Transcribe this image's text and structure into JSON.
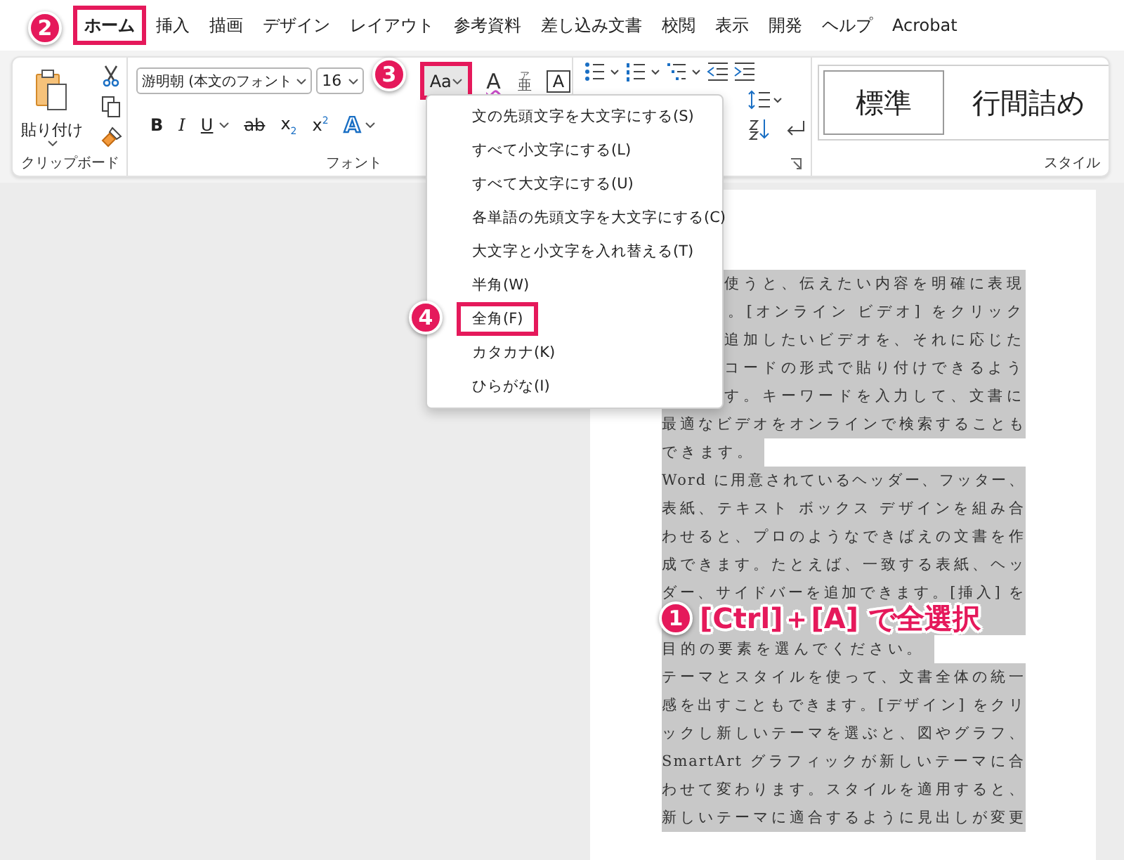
{
  "tabs": [
    {
      "label": "ホーム",
      "selected": true,
      "highlighted": true
    },
    {
      "label": "挿入",
      "selected": false,
      "highlighted": false
    },
    {
      "label": "描画",
      "selected": false,
      "highlighted": false
    },
    {
      "label": "デザイン",
      "selected": false,
      "highlighted": false
    },
    {
      "label": "レイアウト",
      "selected": false,
      "highlighted": false
    },
    {
      "label": "参考資料",
      "selected": false,
      "highlighted": false
    },
    {
      "label": "差し込み文書",
      "selected": false,
      "highlighted": false
    },
    {
      "label": "校閲",
      "selected": false,
      "highlighted": false
    },
    {
      "label": "表示",
      "selected": false,
      "highlighted": false
    },
    {
      "label": "開発",
      "selected": false,
      "highlighted": false
    },
    {
      "label": "ヘルプ",
      "selected": false,
      "highlighted": false
    },
    {
      "label": "Acrobat",
      "selected": false,
      "highlighted": false
    }
  ],
  "ribbon": {
    "clipboard": {
      "paste_label": "貼り付け",
      "group_label": "クリップボード"
    },
    "font": {
      "font_name": "游明朝 (本文のフォント",
      "font_size": "16",
      "top_tools": [
        {
          "kind": "change_case",
          "label": "Aa",
          "highlighted": true
        },
        {
          "kind": "clear",
          "label": "A",
          "highlighted": false
        },
        {
          "kind": "phonetic",
          "label": "亜",
          "ruby": "ア",
          "highlighted": false
        },
        {
          "kind": "enclosed",
          "label": "A",
          "highlighted": false
        }
      ],
      "format_buttons": [
        {
          "kind": "bold",
          "label": "B",
          "menu": false
        },
        {
          "kind": "italic",
          "label": "I",
          "menu": false
        },
        {
          "kind": "underline",
          "label": "U",
          "menu": true
        },
        {
          "kind": "strike",
          "label": "ab",
          "menu": false
        },
        {
          "kind": "plain",
          "label": "x$_{2}$",
          "menu": false
        },
        {
          "kind": "plain",
          "label": "x$^{2}$",
          "menu": false
        },
        {
          "kind": "effect",
          "label": "A",
          "menu": true
        }
      ],
      "group_label": "フォント"
    },
    "styles": {
      "items": [
        {
          "label": "標準",
          "selected": true
        },
        {
          "label": "行間詰め",
          "selected": false
        }
      ],
      "group_label": "スタイル"
    }
  },
  "case_menu": {
    "items": [
      {
        "label": "文の先頭文字を大文字にする(S)",
        "highlighted": false
      },
      {
        "label": "すべて小文字にする(L)",
        "highlighted": false
      },
      {
        "label": "すべて大文字にする(U)",
        "highlighted": false
      },
      {
        "label": "各単語の先頭文字を大文字にする(C)",
        "highlighted": false
      },
      {
        "label": "大文字と小文字を入れ替える(T)",
        "highlighted": false
      },
      {
        "label": "半角(W)",
        "highlighted": false
      },
      {
        "label": "全角(F)",
        "highlighted": true
      },
      {
        "label": "カタカナ(K)",
        "highlighted": false
      },
      {
        "label": "ひらがな(I)",
        "highlighted": false
      }
    ]
  },
  "document": {
    "selected": true,
    "lines": [
      {
        "kind": "partial",
        "text": "使うと、伝えたい内容を明確に表現"
      },
      {
        "kind": "partial",
        "text": "。[オンライン ビデオ] をクリック"
      },
      {
        "kind": "partial",
        "text": "追加したいビデオを、それに応じた"
      },
      {
        "kind": "partial",
        "text": "コードの形式で貼り付けできるよう"
      },
      {
        "kind": "partial",
        "text": "す。キーワードを入力して、文書に"
      },
      {
        "kind": "full",
        "text": "最適なビデオをオンラインで検索することも"
      },
      {
        "kind": "end",
        "text": "できます。"
      },
      {
        "kind": "full",
        "text": "Word に用意されているヘッダー、フッター、"
      },
      {
        "kind": "full",
        "text": "表紙、テキスト ボックス デザインを組み合"
      },
      {
        "kind": "full",
        "text": "わせると、プロのようなできばえの文書を作"
      },
      {
        "kind": "full",
        "text": "成できます。たとえば、一致する表紙、ヘッ"
      },
      {
        "kind": "full",
        "text": "ダー、サイドバーを追加できます。[挿入] を"
      },
      {
        "kind": "covered"
      },
      {
        "kind": "end",
        "text": "目的の要素を選んでください。"
      },
      {
        "kind": "full",
        "text": "テーマとスタイルを使って、文書全体の統一"
      },
      {
        "kind": "full",
        "text": "感を出すこともできます。[デザイン] をクリ"
      },
      {
        "kind": "full",
        "text": "ックし新しいテーマを選ぶと、図やグラフ、"
      },
      {
        "kind": "full",
        "text": "SmartArt グラフィックが新しいテーマに合"
      },
      {
        "kind": "full",
        "text": "わせて変わります。スタイルを適用すると、"
      },
      {
        "kind": "full",
        "text": "新しいテーマに適合するように見出しが変更"
      }
    ]
  },
  "callouts": [
    {
      "kind": "tabs",
      "number": "2"
    },
    {
      "kind": "case_button",
      "number": "3"
    },
    {
      "kind": "menu",
      "number": "4"
    },
    {
      "kind": "document",
      "number": "1",
      "text": "[Ctrl]＋[A] で全選択"
    }
  ]
}
